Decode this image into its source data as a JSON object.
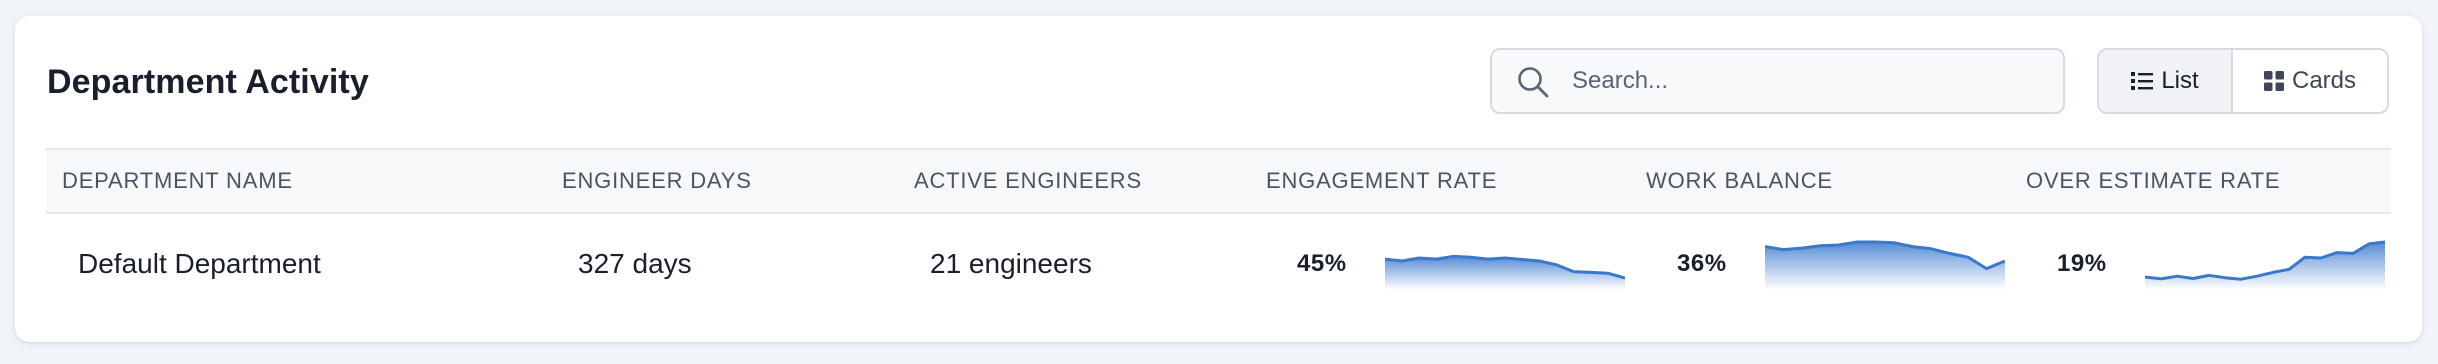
{
  "header": {
    "title": "Department Activity"
  },
  "search": {
    "placeholder": "Search...",
    "value": ""
  },
  "view_toggle": {
    "list_label": "List",
    "cards_label": "Cards",
    "selected": "List"
  },
  "table": {
    "columns": [
      "DEPARTMENT NAME",
      "ENGINEER DAYS",
      "ACTIVE ENGINEERS",
      "ENGAGEMENT RATE",
      "WORK BALANCE",
      "OVER ESTIMATE RATE"
    ],
    "rows": [
      {
        "department_name": "Default Department",
        "engineer_days": "327 days",
        "active_engineers": "21 engineers",
        "engagement_rate": "45%",
        "work_balance": "36%",
        "over_estimate_rate": "19%"
      }
    ]
  },
  "sparklines": {
    "engagement_rate": [
      0.55,
      0.5,
      0.58,
      0.55,
      0.62,
      0.6,
      0.55,
      0.58,
      0.54,
      0.5,
      0.4,
      0.22,
      0.2,
      0.18,
      0.05
    ],
    "work_balance": [
      0.88,
      0.8,
      0.84,
      0.9,
      0.92,
      1.0,
      1.0,
      0.98,
      0.88,
      0.82,
      0.7,
      0.6,
      0.3,
      0.5
    ],
    "over_estimate_rate": [
      0.08,
      0.03,
      0.1,
      0.04,
      0.12,
      0.06,
      0.02,
      0.1,
      0.2,
      0.28,
      0.6,
      0.58,
      0.72,
      0.7,
      0.95,
      1.0
    ]
  },
  "colors": {
    "spark_line": "#3a78c9",
    "spark_fill_top": "#4b86d1",
    "spark_fill_bottom": "#ffffff",
    "accent": "#3a78c9"
  },
  "icons": {
    "search": "search-icon",
    "list": "list-icon",
    "cards": "grid-icon"
  }
}
